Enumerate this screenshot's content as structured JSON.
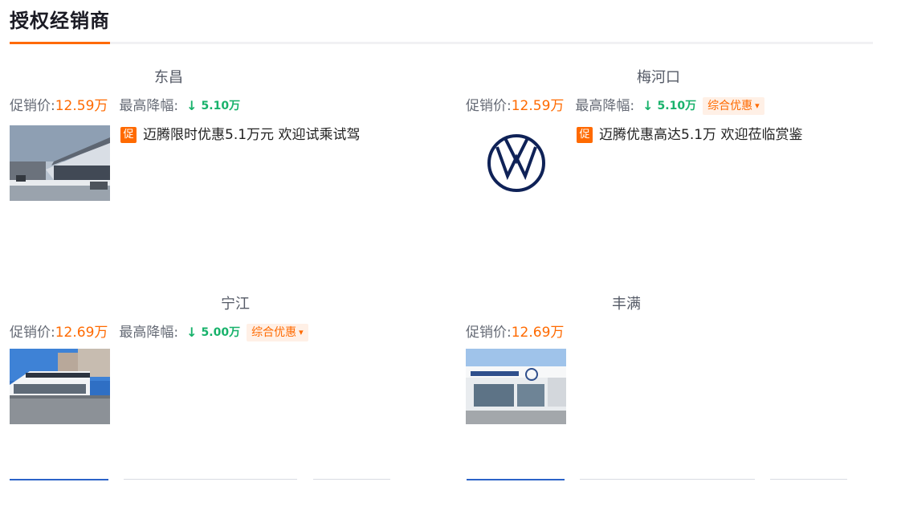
{
  "header": {
    "title": "授权经销商"
  },
  "labels": {
    "price": "促销价:",
    "max_drop": "最高降幅:"
  },
  "icons": {
    "drop": "down-arrow-icon",
    "promo": "chevron-down-icon",
    "cu": "promo-badge-icon",
    "vw": "volkswagen-logo-icon"
  },
  "colors": {
    "accent": "#ff6a00",
    "drop": "#18b26b",
    "primary_button": "#2b63c8"
  },
  "dealers": [
    {
      "name": "东昌",
      "price": "12.59万",
      "drop_arrow": "↓",
      "drop": "5.10万",
      "news_badge": "促",
      "news": "迈腾限时优惠5.1万元 欢迎试乘试驾"
    },
    {
      "name": "梅河口",
      "price": "12.59万",
      "drop_arrow": "↓",
      "drop": "5.10万",
      "promo": "综合优惠",
      "news_badge": "促",
      "news": "迈腾优惠高达5.1万 欢迎莅临赏鉴"
    },
    {
      "name": "宁江",
      "price": "12.69万",
      "drop_arrow": "↓",
      "drop": "5.00万",
      "promo": "综合优惠"
    },
    {
      "name": "丰满",
      "price": "12.69万"
    }
  ]
}
